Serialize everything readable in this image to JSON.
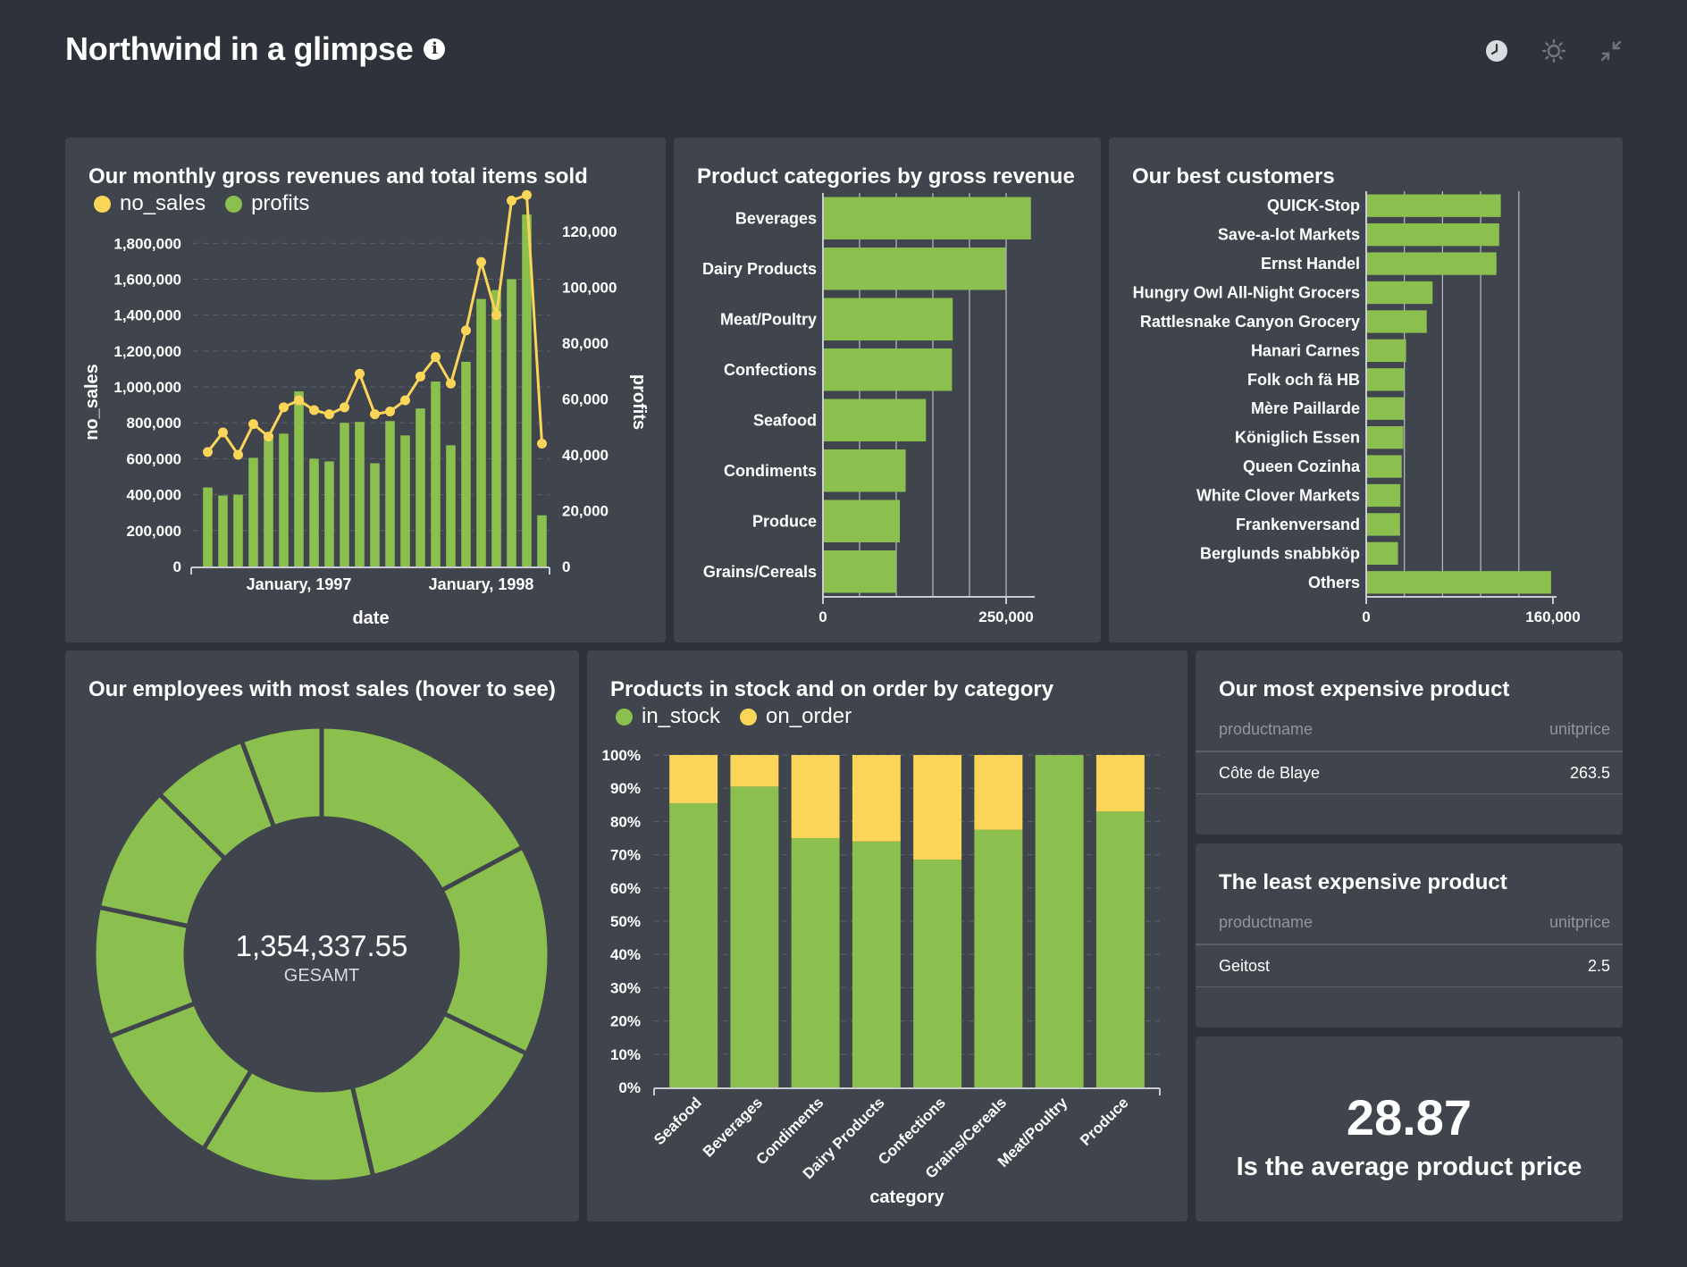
{
  "dashboard": {
    "title": "Northwind in a glimpse"
  },
  "colors": {
    "green": "#8bc04e",
    "yellow": "#fbd558",
    "background": "#2e333b",
    "card": "#40444d"
  },
  "icons": [
    "clock-icon",
    "theme-icon",
    "collapse-icon"
  ],
  "revenue_card": {
    "title": "Our monthly gross revenues and total items sold",
    "legend": [
      "no_sales",
      "profits"
    ],
    "xlabel": "date",
    "ylabel_left": "no_sales",
    "ylabel_right": "profits",
    "left_ticks": [
      "0",
      "200,000",
      "400,000",
      "600,000",
      "800,000",
      "1,000,000",
      "1,200,000",
      "1,400,000",
      "1,600,000",
      "1,800,000"
    ],
    "right_ticks": [
      "0",
      "20,000",
      "40,000",
      "60,000",
      "80,000",
      "100,000",
      "120,000"
    ],
    "x_ticks": [
      "January, 1997",
      "January, 1998"
    ]
  },
  "categories_card": {
    "title": "Product categories by gross revenue",
    "x_ticks": [
      "0",
      "250,000"
    ]
  },
  "customers_card": {
    "title": "Our best customers",
    "x_ticks": [
      "0",
      "160,000"
    ]
  },
  "employees_card": {
    "title": "Our employees with most sales (hover to see)",
    "center_value": "1,354,337.55",
    "center_label": "GESAMT"
  },
  "stock_card": {
    "title": "Products in stock and on order by category",
    "legend": [
      "in_stock",
      "on_order"
    ],
    "xlabel": "category",
    "y_ticks": [
      "0%",
      "10%",
      "20%",
      "30%",
      "40%",
      "50%",
      "60%",
      "70%",
      "80%",
      "90%",
      "100%"
    ]
  },
  "expensive_card": {
    "title": "Our most expensive product",
    "col_name": "productname",
    "col_price": "unitprice",
    "row_name": "Côte de Blaye",
    "row_price": "263.5"
  },
  "cheap_card": {
    "title": "The least expensive product",
    "col_name": "productname",
    "col_price": "unitprice",
    "row_name": "Geitost",
    "row_price": "2.5"
  },
  "avg_card": {
    "value": "28.87",
    "label": "Is the average product price"
  },
  "chart_data": [
    {
      "type": "bar",
      "title": "Our monthly gross revenues and total items sold",
      "xlabel": "date",
      "ylabel": "no_sales",
      "ylim": [
        0,
        2100000
      ],
      "x": [
        "1996-07",
        "1996-08",
        "1996-09",
        "1996-10",
        "1996-11",
        "1996-12",
        "1997-01",
        "1997-02",
        "1997-03",
        "1997-04",
        "1997-05",
        "1997-06",
        "1997-07",
        "1997-08",
        "1997-09",
        "1997-10",
        "1997-11",
        "1997-12",
        "1998-01",
        "1998-02",
        "1998-03",
        "1998-04",
        "1998-05"
      ],
      "series": [
        {
          "name": "no_sales",
          "type": "bar",
          "axis": "left",
          "values": [
            440000,
            395000,
            400000,
            605000,
            730000,
            740000,
            975000,
            600000,
            585000,
            800000,
            805000,
            575000,
            810000,
            730000,
            880000,
            1030000,
            675000,
            1140000,
            1490000,
            1540000,
            1600000,
            1960000,
            285000
          ]
        },
        {
          "name": "profits",
          "type": "line",
          "axis": "right",
          "ylim": [
            0,
            135000
          ],
          "values": [
            41000,
            48000,
            40000,
            51000,
            46500,
            57000,
            59500,
            56000,
            54500,
            57000,
            69000,
            54500,
            55500,
            59500,
            68000,
            75000,
            65500,
            84500,
            109000,
            90000,
            131000,
            133000,
            44000
          ]
        }
      ]
    },
    {
      "type": "bar",
      "orientation": "horizontal",
      "title": "Product categories by gross revenue",
      "categories": [
        "Beverages",
        "Dairy Products",
        "Meat/Poultry",
        "Confections",
        "Seafood",
        "Condiments",
        "Produce",
        "Grains/Cereals"
      ],
      "values": [
        286000,
        251000,
        178000,
        177000,
        141000,
        113000,
        105000,
        100000
      ],
      "xlim": [
        0,
        290000
      ]
    },
    {
      "type": "bar",
      "orientation": "horizontal",
      "title": "Our best customers",
      "categories": [
        "QUICK-Stop",
        "Save-a-lot Markets",
        "Ernst Handel",
        "Hungry Owl All-Night Grocers",
        "Rattlesnake Canyon Grocery",
        "Hanari Carnes",
        "Folk och fä HB",
        "Mère Paillarde",
        "Königlich Essen",
        "Queen Cozinha",
        "White Clover Markets",
        "Frankenversand",
        "Berglunds snabbköp",
        "Others"
      ],
      "values": [
        117000,
        115600,
        113200,
        57300,
        52200,
        34100,
        32600,
        32200,
        31700,
        30300,
        29100,
        28800,
        27000,
        161000
      ],
      "xlim": [
        0,
        165000
      ]
    },
    {
      "type": "pie",
      "title": "Our employees with most sales (hover to see)",
      "total": "1,354,337.55",
      "values": [
        232891,
        202813,
        192108,
        166538,
        141296,
        124568,
        123032,
        93148,
        77308
      ]
    },
    {
      "type": "bar",
      "stacked": true,
      "title": "Products in stock and on order by category",
      "xlabel": "category",
      "ylim": [
        0,
        100
      ],
      "categories": [
        "Seafood",
        "Beverages",
        "Condiments",
        "Dairy Products",
        "Confections",
        "Grains/Cereals",
        "Meat/Poultry",
        "Produce"
      ],
      "series": [
        {
          "name": "in_stock",
          "values": [
            85.5,
            90.5,
            75,
            74,
            68.5,
            77.5,
            100,
            83
          ]
        },
        {
          "name": "on_order",
          "values": [
            14.5,
            9.5,
            25,
            26,
            31.5,
            22.5,
            0,
            17
          ]
        }
      ]
    }
  ]
}
